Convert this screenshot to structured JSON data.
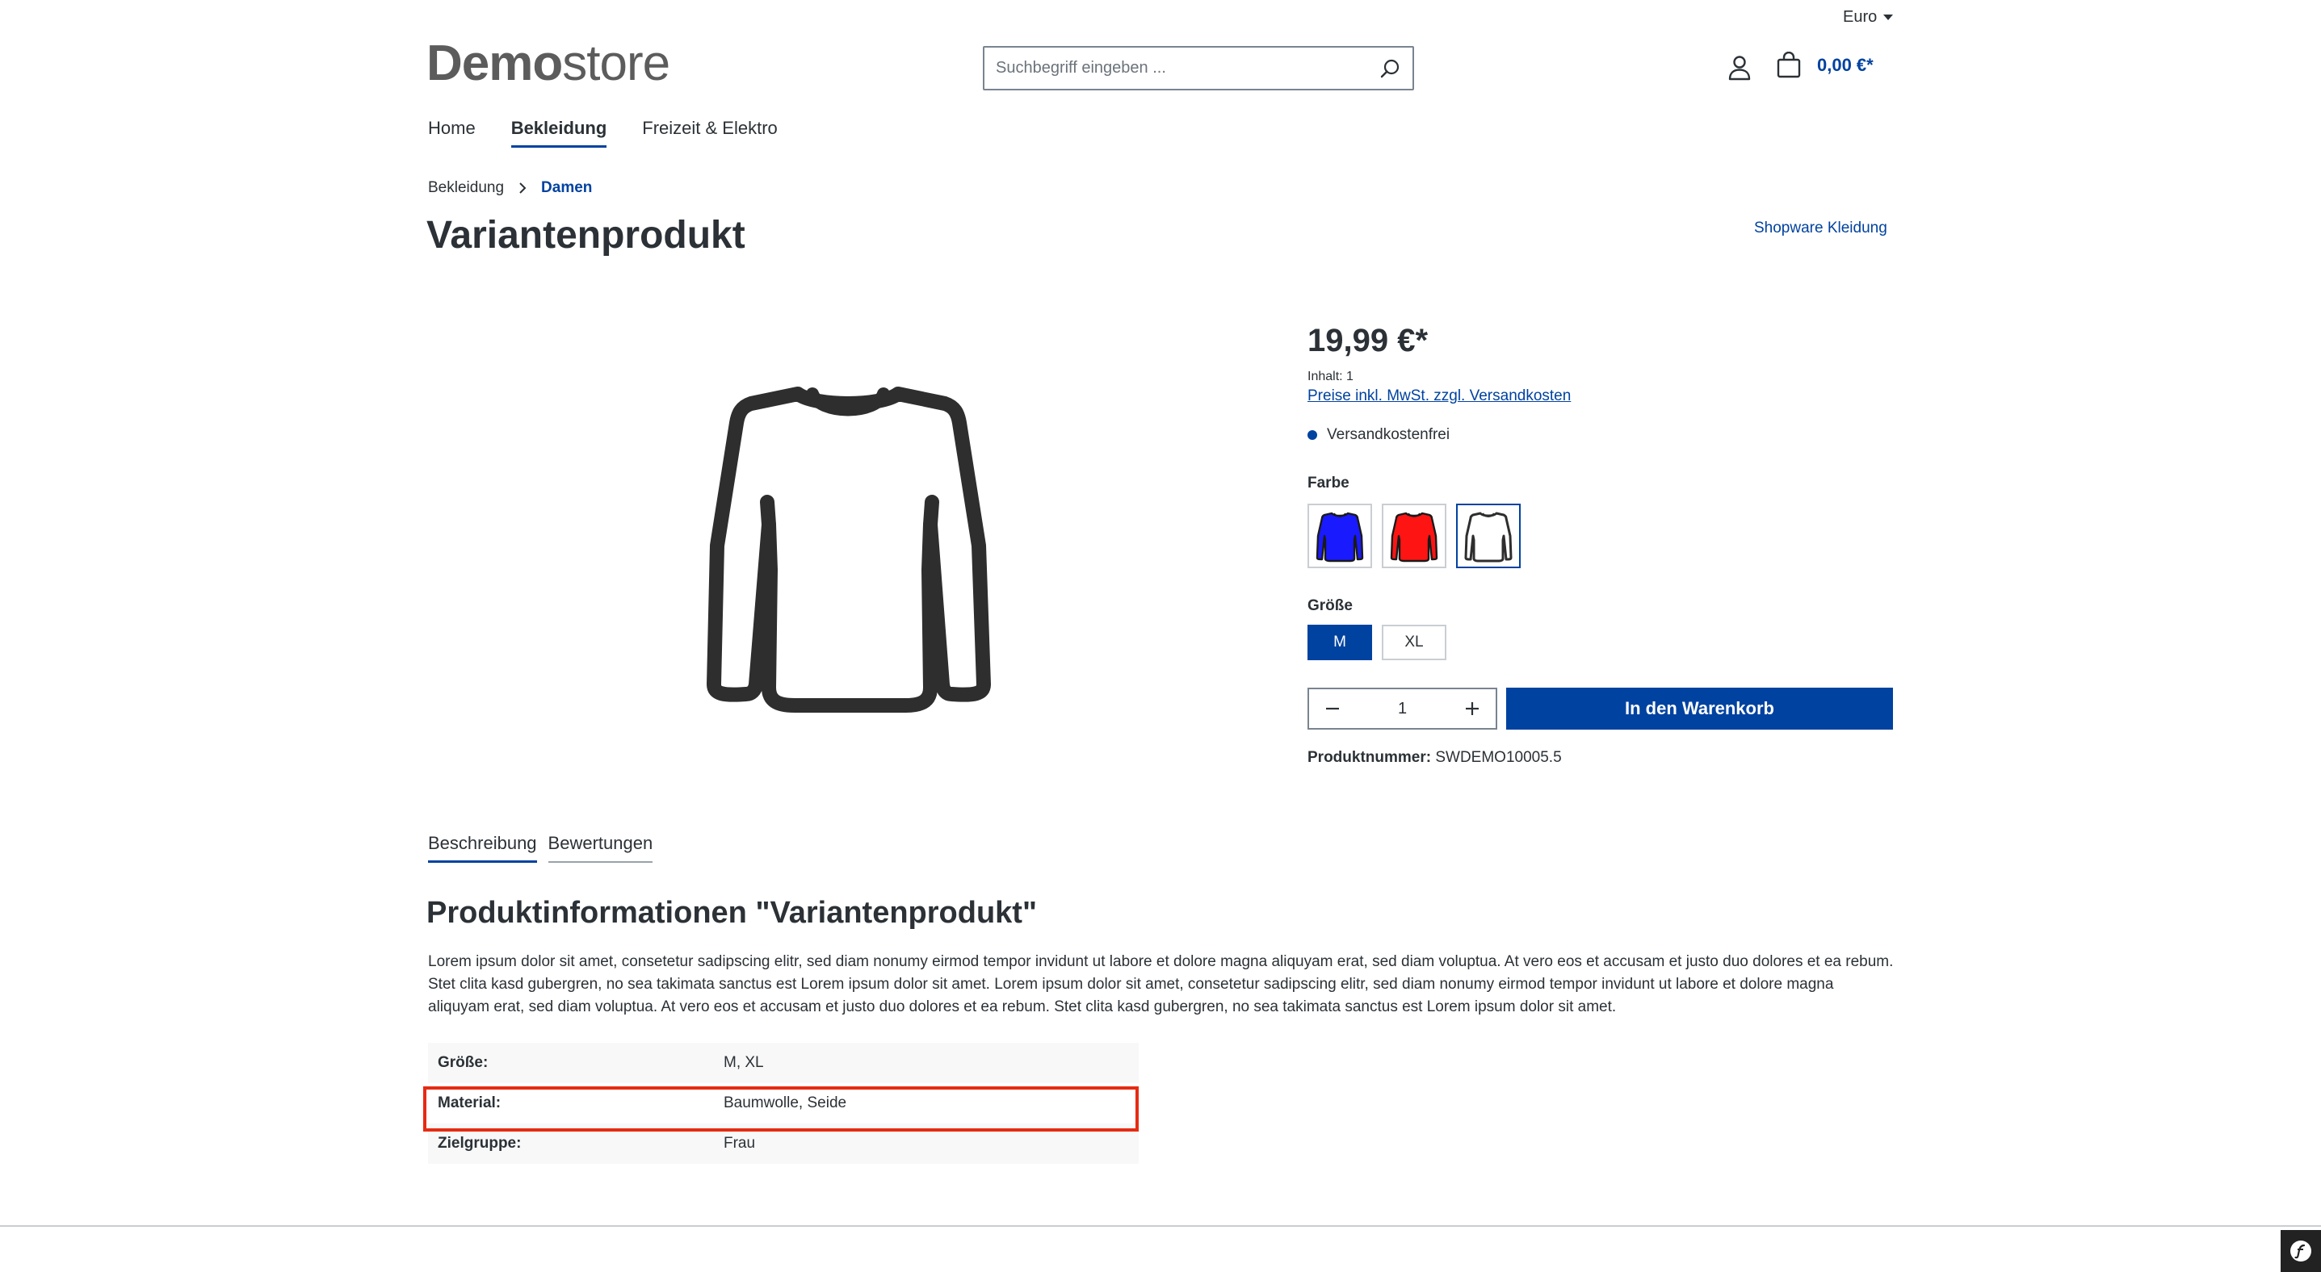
{
  "header": {
    "currency": "Euro",
    "logo_bold": "Demo",
    "logo_light": "store",
    "search_placeholder": "Suchbegriff eingeben ...",
    "cart_total": "0,00 €*"
  },
  "nav": {
    "items": [
      {
        "label": "Home",
        "active": false
      },
      {
        "label": "Bekleidung",
        "active": true
      },
      {
        "label": "Freizeit & Elektro",
        "active": false
      }
    ]
  },
  "breadcrumb": {
    "parent": "Bekleidung",
    "current": "Damen"
  },
  "product": {
    "title": "Variantenprodukt",
    "manufacturer": "Shopware Kleidung",
    "price": "19,99 €*",
    "content": "Inhalt: 1",
    "tax_link": "Preise inkl. MwSt. zzgl. Versandkosten",
    "shipping": "Versandkostenfrei",
    "color_label": "Farbe",
    "colors": [
      {
        "name": "blau",
        "hex": "#1a1aff"
      },
      {
        "name": "rot",
        "hex": "#ff1414"
      },
      {
        "name": "weiß",
        "hex": "#ffffff"
      }
    ],
    "size_label": "Größe",
    "sizes": [
      "M",
      "XL"
    ],
    "quantity": "1",
    "add_to_cart": "In den Warenkorb",
    "sku_label": "Produktnummer:",
    "sku": "SWDEMO10005.5"
  },
  "tabs": [
    "Beschreibung",
    "Bewertungen"
  ],
  "info": {
    "heading": "Produktinformationen \"Variantenprodukt\"",
    "description": "Lorem ipsum dolor sit amet, consetetur sadipscing elitr, sed diam nonumy eirmod tempor invidunt ut labore et dolore magna aliquyam erat, sed diam voluptua. At vero eos et accusam et justo duo dolores et ea rebum. Stet clita kasd gubergren, no sea takimata sanctus est Lorem ipsum dolor sit amet. Lorem ipsum dolor sit amet, consetetur sadipscing elitr, sed diam nonumy eirmod tempor invidunt ut labore et dolore magna aliquyam erat, sed diam voluptua. At vero eos et accusam et justo duo dolores et ea rebum. Stet clita kasd gubergren, no sea takimata sanctus est Lorem ipsum dolor sit amet.",
    "properties": [
      {
        "key": "Größe:",
        "value": "M, XL"
      },
      {
        "key": "Material:",
        "value": "Baumwolle, Seide"
      },
      {
        "key": "Zielgruppe:",
        "value": "Frau"
      }
    ]
  },
  "colors": {
    "accent": "#0042a0",
    "highlight": "#e52b13",
    "text": "#2b3136"
  }
}
